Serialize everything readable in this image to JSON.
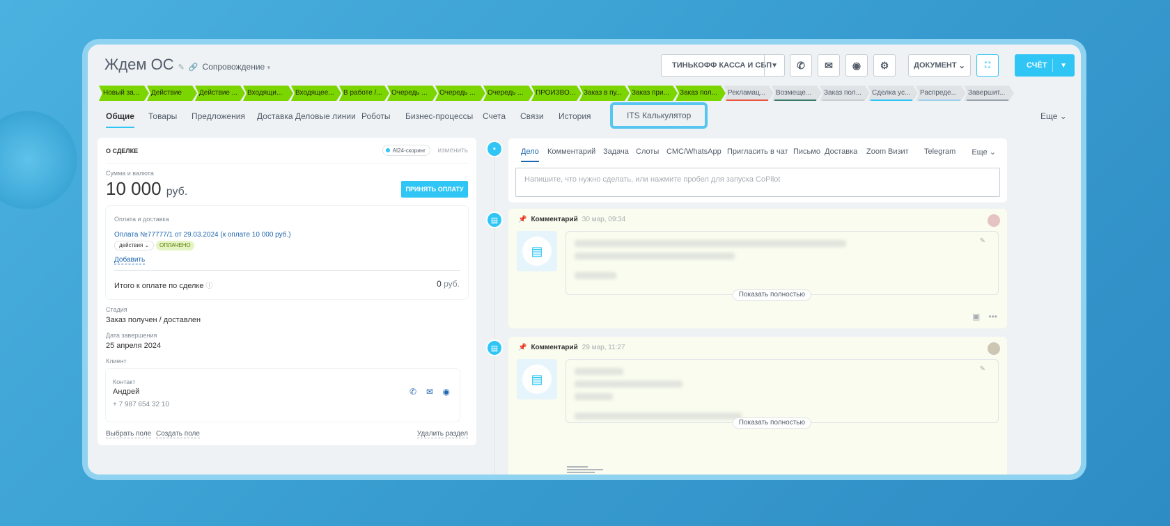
{
  "header": {
    "title": "Ждем ОС",
    "pipeline": "Сопровождение",
    "tinkoff_label": "ТИНЬКОФФ КАССА И СБП",
    "document_label": "ДОКУМЕНТ",
    "invoice_label": "СЧЁТ"
  },
  "stages": [
    {
      "label": "Новый за...",
      "state": "done"
    },
    {
      "label": "Действие",
      "state": "done"
    },
    {
      "label": "Действие ...",
      "state": "done"
    },
    {
      "label": "Входящи...",
      "state": "done"
    },
    {
      "label": "Входящее...",
      "state": "done"
    },
    {
      "label": "В работе /...",
      "state": "done"
    },
    {
      "label": "Очередь ...",
      "state": "done"
    },
    {
      "label": "Очередь ...",
      "state": "done"
    },
    {
      "label": "Очередь ...",
      "state": "done"
    },
    {
      "label": "ПРОИЗВО...",
      "state": "done"
    },
    {
      "label": "Заказ в пу...",
      "state": "done"
    },
    {
      "label": "Заказ при...",
      "state": "done"
    },
    {
      "label": "Заказ пол...",
      "state": "done"
    },
    {
      "label": "Рекламац...",
      "state": "todo",
      "color": "#e8543e"
    },
    {
      "label": "Возмеще...",
      "state": "todo",
      "color": "#3c7a6b"
    },
    {
      "label": "Заказ пол...",
      "state": "todo",
      "color": "#c6cdd3"
    },
    {
      "label": "Сделка ус...",
      "state": "todo",
      "color": "#2fc6f6"
    },
    {
      "label": "Распреде...",
      "state": "todo",
      "color": "#9dcfef"
    },
    {
      "label": "Завершит...",
      "state": "todo",
      "color": "#9aa2ab"
    }
  ],
  "tabs": {
    "general": "Общие",
    "products": "Товары",
    "offers": "Предложения",
    "delivery": "Доставка Деловые линии",
    "robots": "Роботы",
    "bizproc": "Бизнес-процессы",
    "invoices": "Счета",
    "links": "Связи",
    "history": "История",
    "its": "ITS Калькулятор",
    "more": "Еще"
  },
  "deal": {
    "section_title": "О СДЕЛКЕ",
    "ai_scoring": "AI24-скоринг",
    "change": "изменить",
    "amount_label": "Сумма и валюта",
    "amount": "10 000",
    "currency": "руб.",
    "accept_payment": "ПРИНЯТЬ ОПЛАТУ",
    "payment_block_label": "Оплата и доставка",
    "payment_link": "Оплата №77777/1 от 29.03.2024 (к оплате 10 000 руб.)",
    "actions": "действия",
    "paid_badge": "ОПЛАЧЕНО",
    "add": "Добавить",
    "total_label": "Итого к оплате по сделке",
    "total_value": "0",
    "total_currency": "руб.",
    "stage_label": "Стадия",
    "stage_value": "Заказ получен / доставлен",
    "close_date_label": "Дата завершения",
    "close_date_value": "25 апреля 2024",
    "client_label": "Клиент",
    "contact_label": "Контакт",
    "contact_name": "Андрей",
    "contact_phone": "+ 7 987 654 32 10",
    "select_field": "Выбрать поле",
    "create_field": "Создать поле",
    "delete_section": "Удалить раздел"
  },
  "composer": {
    "tabs": [
      "Дело",
      "Комментарий",
      "Задача",
      "Слоты",
      "СМС/WhatsApp",
      "Пригласить в чат",
      "Письмо",
      "Доставка",
      "Zoom",
      "Визит",
      "Telegram"
    ],
    "more": "Еще",
    "placeholder": "Напишите, что нужно сделать, или нажмите пробел для запуска CoPilot"
  },
  "timeline": [
    {
      "type": "Комментарий",
      "time": "30 мар, 09:34",
      "show_full": "Показать полностью"
    },
    {
      "type": "Комментарий",
      "time": "29 мар, 11:27",
      "show_full": "Показать полностью"
    }
  ],
  "icons": {
    "accent": "#2fc6f6",
    "stage_done": "#7bd500"
  }
}
